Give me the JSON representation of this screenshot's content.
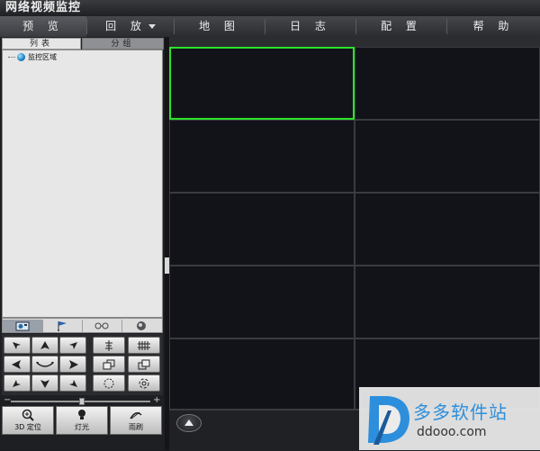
{
  "window": {
    "title": "网络视频监控"
  },
  "menu": [
    {
      "label": "预 览",
      "active": true
    },
    {
      "label": "回 放",
      "has_dropdown": true
    },
    {
      "label": "地 图"
    },
    {
      "label": "日 志"
    },
    {
      "label": "配 置"
    },
    {
      "label": "帮 助"
    }
  ],
  "left_tabs": [
    "列表",
    "分组"
  ],
  "tree": {
    "root_label": "监控区域",
    "icon": "globe-icon"
  },
  "ptz_tabs": [
    "camera-ptz-icon",
    "preset-flag-icon",
    "cruise-icon",
    "track-icon"
  ],
  "ptz_buttons": {
    "directions": [
      "up-left",
      "up",
      "up-right",
      "left",
      "auto",
      "right",
      "down-left",
      "down",
      "down-right"
    ],
    "right_group": [
      "zoom-in",
      "zoom-out",
      "focus-near",
      "focus-far",
      "iris-open",
      "iris-close"
    ]
  },
  "speed_slider": {
    "minus": "−",
    "plus": "+",
    "value": 0.5
  },
  "bottom_buttons": [
    {
      "label": "3D 定位",
      "icon": "3d-zoom-icon"
    },
    {
      "label": "灯光",
      "icon": "light-icon"
    },
    {
      "label": "雨刷",
      "icon": "wiper-icon"
    }
  ],
  "video_grid": {
    "columns": 2,
    "rows": 5,
    "selected_index": 0
  },
  "watermark": {
    "text_cn": "多多软件站",
    "text_en": "ddooo.com"
  },
  "colors": {
    "selected_border": "#2be32b",
    "brand_blue": "#2d8fdc"
  }
}
